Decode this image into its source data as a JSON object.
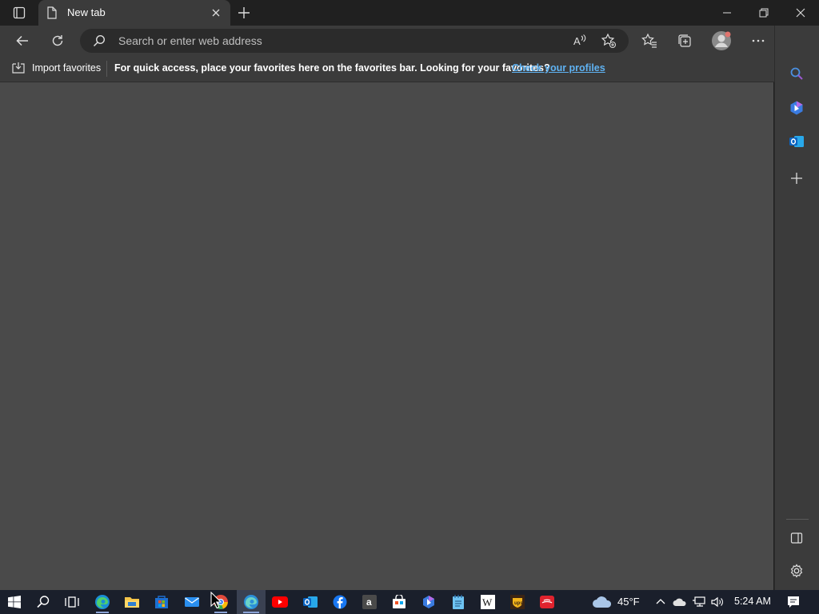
{
  "browser": {
    "tab": {
      "title": "New tab"
    },
    "address_bar": {
      "placeholder": "Search or enter web address"
    },
    "favorites_bar": {
      "import_label": "Import favorites",
      "message": "For quick access, place your favorites here on the favorites bar. Looking for your favorites?",
      "link": "Check your profiles"
    },
    "toolbar_icons": [
      "back-icon",
      "refresh-icon",
      "read-aloud-icon",
      "add-favorite-icon",
      "favorites-icon",
      "collections-icon",
      "profile-icon",
      "more-icon",
      "copilot-icon"
    ],
    "sidebar_icons": [
      "search-icon",
      "copilot-icon",
      "outlook-icon",
      "add-icon",
      "hide-sidebar-icon",
      "settings-icon"
    ]
  },
  "taskbar": {
    "weather": {
      "temp": "45°F"
    },
    "clock": "5:24 AM",
    "apps": [
      "start",
      "search",
      "task-view",
      "edge",
      "file-explorer",
      "microsoft-store",
      "mail",
      "chrome",
      "edge-beta",
      "youtube",
      "outlook",
      "facebook",
      "amazon",
      "store-bag",
      "copilot",
      "notepad",
      "wikipedia",
      "ups",
      "app-red"
    ]
  },
  "colors": {
    "accent_link": "#5fb2f2",
    "content_bg": "#4a4a4a",
    "chrome_bg": "#3b3b3b",
    "taskbar_bg": "#1a1f2b"
  }
}
